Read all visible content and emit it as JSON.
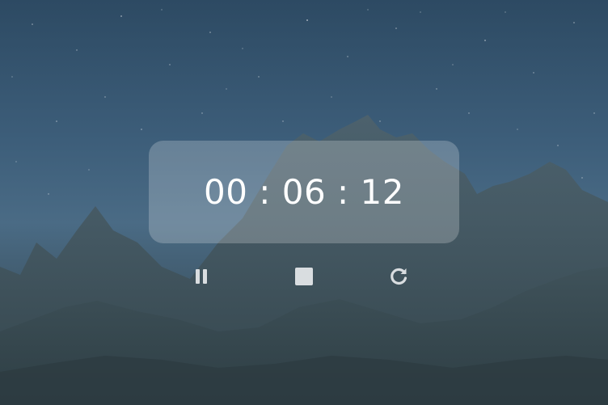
{
  "timer": {
    "display": "00 : 06 : 12"
  },
  "controls": [
    {
      "icon": "pause-icon"
    },
    {
      "icon": "stop-icon"
    },
    {
      "icon": "restart-icon"
    }
  ],
  "colors": {
    "sky_top": "#2d4a63",
    "sky_mid": "#4a6b85",
    "mountain": "#3d4f57",
    "card": "rgba(255,255,255,0.22)",
    "text": "#ffffff",
    "icon": "#d9dde0"
  }
}
